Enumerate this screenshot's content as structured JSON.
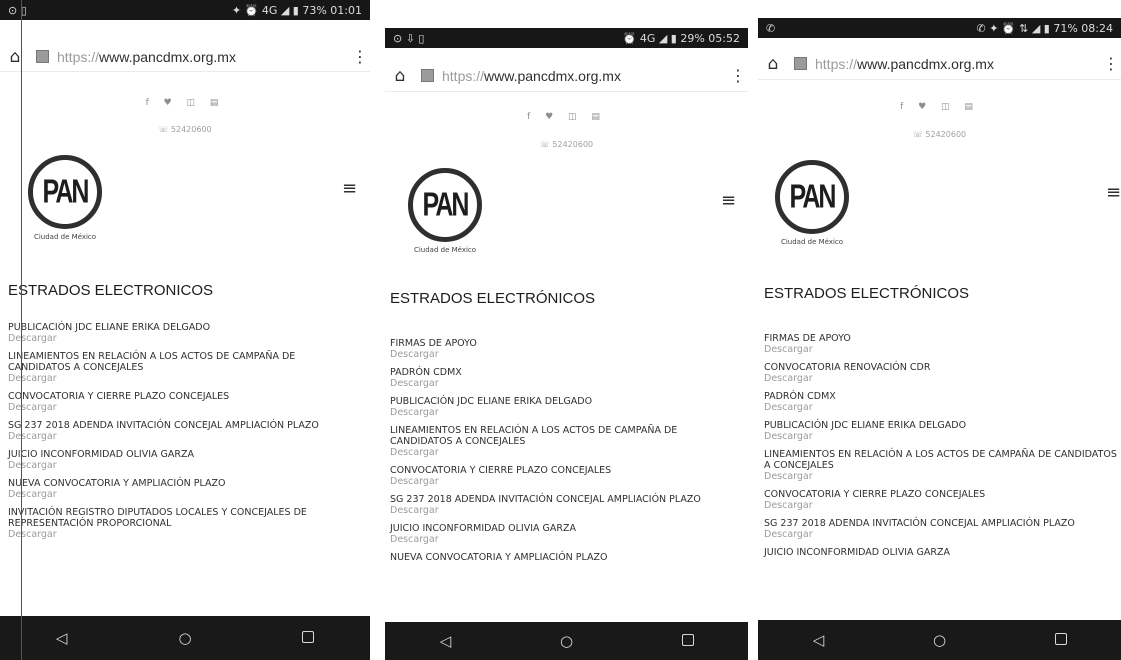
{
  "screens": [
    {
      "status": {
        "left": "⊙ ▯",
        "right": "✦ ⏰ 4G ◢ ▮ 73% 01:01"
      },
      "url_scheme": "https://",
      "url_host": "www.pancdmx.org.mx",
      "social": "f ♥ ◫ ▤",
      "phone": "☏ 52420600",
      "logo_text": "PAN",
      "logo_city": "Ciudad de México",
      "heading": "ESTRADOS ELECTRONICOS",
      "download_label": "Descargar",
      "items": [
        "PUBLICACIÓN JDC ELIANE ERIKA DELGADO",
        "LINEAMIENTOS EN RELACIÓN A LOS ACTOS DE CAMPAÑA DE CANDIDATOS A CONCEJALES",
        "CONVOCATORIA Y CIERRE PLAZO CONCEJALES",
        "SG 237 2018 ADENDA INVITACIÓN CONCEJAL AMPLIACIÓN PLAZO",
        "JUICIO INCONFORMIDAD OLIVIA GARZA",
        "NUEVA CONVOCATORIA Y AMPLIACIÓN PLAZO",
        "INVITACIÓN REGISTRO DIPUTADOS LOCALES Y CONCEJALES DE REPRESENTACIÓN PROPORCIONAL"
      ]
    },
    {
      "status": {
        "left": "⊙ ⇩ ▯",
        "right": "⏰ 4G ◢ ▮ 29% 05:52"
      },
      "url_scheme": "https://",
      "url_host": "www.pancdmx.org.mx",
      "social": "f ♥ ◫ ▤",
      "phone": "☏ 52420600",
      "logo_text": "PAN",
      "logo_city": "Ciudad de México",
      "heading": "ESTRADOS ELECTRÓNICOS",
      "download_label": "Descargar",
      "items": [
        "FIRMAS DE APOYO",
        "PADRÓN CDMX",
        "PUBLICACIÓN JDC ELIANE ERIKA DELGADO",
        "LINEAMIENTOS EN RELACIÓN A LOS ACTOS DE CAMPAÑA DE CANDIDATOS A CONCEJALES",
        "CONVOCATORIA Y CIERRE PLAZO CONCEJALES",
        "SG 237 2018 ADENDA INVITACIÓN CONCEJAL AMPLIACIÓN PLAZO",
        "JUICIO INCONFORMIDAD OLIVIA GARZA",
        "NUEVA CONVOCATORIA Y AMPLIACIÓN PLAZO"
      ]
    },
    {
      "status": {
        "left": "✆",
        "right": "✆ ✦ ⏰ ⇅ ◢ ▮ 71% 08:24"
      },
      "url_scheme": "https://",
      "url_host": "www.pancdmx.org.mx",
      "social": "f ♥ ◫ ▤",
      "phone": "☏ 52420600",
      "logo_text": "PAN",
      "logo_city": "Ciudad de México",
      "heading": "ESTRADOS ELECTRÓNICOS",
      "download_label": "Descargar",
      "items": [
        "FIRMAS DE APOYO",
        "CONVOCATORIA RENOVACIÓN CDR",
        "PADRÓN CDMX",
        "PUBLICACIÓN JDC ELIANE ERIKA DELGADO",
        "LINEAMIENTOS EN RELACIÓN A LOS ACTOS DE CAMPAÑA DE CANDIDATOS A CONCEJALES",
        "CONVOCATORIA Y CIERRE PLAZO CONCEJALES",
        "SG 237 2018 ADENDA INVITACIÓN CONCEJAL AMPLIACIÓN PLAZO",
        "JUICIO INCONFORMIDAD OLIVIA GARZA"
      ]
    }
  ],
  "nav": {
    "back": "◁",
    "home": "○",
    "recents": "□"
  }
}
